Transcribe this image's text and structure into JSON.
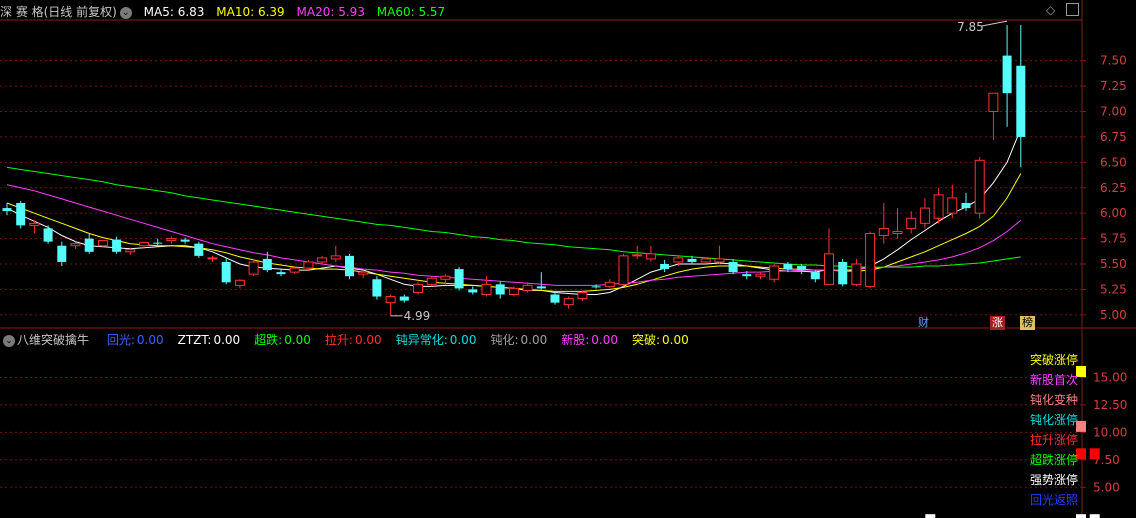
{
  "main_header": {
    "title": "深 赛 格(日线 前复权)",
    "ma5": "MA5: 6.83",
    "ma10": "MA10: 6.39",
    "ma20": "MA20: 5.93",
    "ma60": "MA60: 5.57",
    "colors": {
      "ma5": "#ffffff",
      "ma10": "#ffff00",
      "ma20": "#ff40ff",
      "ma60": "#00ff00"
    }
  },
  "sub_header": {
    "title": "八维突破擒牛",
    "items": [
      {
        "label": "回光:",
        "value": "0.00",
        "color": "#3c64ff"
      },
      {
        "label": "ZTZT:",
        "value": "0.00",
        "color": "#ffffff"
      },
      {
        "label": "超跌:",
        "value": "0.00",
        "color": "#00ff00"
      },
      {
        "label": "拉升:",
        "value": "0.00",
        "color": "#ff3030"
      },
      {
        "label": "钝异常化:",
        "value": "0.00",
        "color": "#00e0e0"
      },
      {
        "label": "钝化:",
        "value": "0.00",
        "color": "#a0a0a0"
      },
      {
        "label": "新股:",
        "value": "0.00",
        "color": "#ff40ff"
      },
      {
        "label": "突破:",
        "value": "0.00",
        "color": "#ffff00"
      }
    ]
  },
  "price_annotations": {
    "high": "7.85",
    "low": "4.99"
  },
  "badges": {
    "cai": "财",
    "zhang": "涨",
    "bang": "榜"
  },
  "corner_icons": [
    "diamond-icon",
    "window-icon"
  ],
  "signal_labels": [
    {
      "text": "突破涨停",
      "color": "#ffff00"
    },
    {
      "text": "新股首次",
      "color": "#ff40ff"
    },
    {
      "text": "钝化变种",
      "color": "#ff8080"
    },
    {
      "text": "钝化涨停",
      "color": "#00e0e0"
    },
    {
      "text": "拉升涨停",
      "color": "#ff3030"
    },
    {
      "text": "超跌涨停",
      "color": "#00ff00"
    },
    {
      "text": "强势涨停",
      "color": "#ffffff"
    },
    {
      "text": "回光返照",
      "color": "#2040ff"
    }
  ],
  "chart_data": [
    {
      "type": "candlestick",
      "yticks": [
        "7.50",
        "7.25",
        "7.00",
        "6.75",
        "6.50",
        "6.25",
        "6.00",
        "5.75",
        "5.50",
        "5.25",
        "5.00"
      ],
      "ylim": [
        4.9,
        7.9
      ],
      "candles": [
        [
          6.05,
          6.1,
          5.98,
          6.02
        ],
        [
          6.1,
          6.12,
          5.85,
          5.88
        ],
        [
          5.88,
          5.93,
          5.8,
          5.9
        ],
        [
          5.85,
          5.88,
          5.7,
          5.72
        ],
        [
          5.68,
          5.72,
          5.48,
          5.52
        ],
        [
          5.68,
          5.72,
          5.65,
          5.7
        ],
        [
          5.75,
          5.8,
          5.6,
          5.62
        ],
        [
          5.68,
          5.74,
          5.66,
          5.73
        ],
        [
          5.74,
          5.77,
          5.6,
          5.62
        ],
        [
          5.62,
          5.66,
          5.59,
          5.64
        ],
        [
          5.68,
          5.72,
          5.65,
          5.71
        ],
        [
          5.71,
          5.75,
          5.68,
          5.7
        ],
        [
          5.73,
          5.77,
          5.7,
          5.75
        ],
        [
          5.74,
          5.76,
          5.7,
          5.72
        ],
        [
          5.7,
          5.72,
          5.56,
          5.58
        ],
        [
          5.55,
          5.58,
          5.52,
          5.56
        ],
        [
          5.52,
          5.56,
          5.3,
          5.32
        ],
        [
          5.29,
          5.35,
          5.26,
          5.34
        ],
        [
          5.4,
          5.55,
          5.38,
          5.52
        ],
        [
          5.55,
          5.62,
          5.42,
          5.44
        ],
        [
          5.42,
          5.45,
          5.38,
          5.4
        ],
        [
          5.42,
          5.48,
          5.4,
          5.46
        ],
        [
          5.46,
          5.54,
          5.44,
          5.52
        ],
        [
          5.52,
          5.58,
          5.5,
          5.56
        ],
        [
          5.55,
          5.68,
          5.52,
          5.58
        ],
        [
          5.58,
          5.6,
          5.35,
          5.38
        ],
        [
          5.4,
          5.44,
          5.36,
          5.42
        ],
        [
          5.35,
          5.38,
          5.15,
          5.18
        ],
        [
          5.12,
          5.2,
          4.99,
          5.18
        ],
        [
          5.18,
          5.2,
          5.12,
          5.14
        ],
        [
          5.22,
          5.32,
          5.2,
          5.3
        ],
        [
          5.3,
          5.38,
          5.28,
          5.36
        ],
        [
          5.35,
          5.4,
          5.3,
          5.38
        ],
        [
          5.45,
          5.47,
          5.24,
          5.26
        ],
        [
          5.25,
          5.28,
          5.2,
          5.22
        ],
        [
          5.2,
          5.38,
          5.18,
          5.3
        ],
        [
          5.3,
          5.33,
          5.16,
          5.2
        ],
        [
          5.2,
          5.28,
          5.18,
          5.26
        ],
        [
          5.24,
          5.32,
          5.22,
          5.29
        ],
        [
          5.28,
          5.42,
          5.25,
          5.26
        ],
        [
          5.2,
          5.23,
          5.1,
          5.12
        ],
        [
          5.1,
          5.18,
          5.06,
          5.16
        ],
        [
          5.16,
          5.24,
          5.14,
          5.22
        ],
        [
          5.28,
          5.3,
          5.26,
          5.27
        ],
        [
          5.28,
          5.35,
          5.26,
          5.32
        ],
        [
          5.3,
          5.6,
          5.28,
          5.58
        ],
        [
          5.58,
          5.68,
          5.55,
          5.59
        ],
        [
          5.55,
          5.68,
          5.52,
          5.6
        ],
        [
          5.5,
          5.54,
          5.42,
          5.45
        ],
        [
          5.52,
          5.58,
          5.48,
          5.56
        ],
        [
          5.55,
          5.58,
          5.5,
          5.52
        ],
        [
          5.52,
          5.56,
          5.5,
          5.55
        ],
        [
          5.52,
          5.68,
          5.5,
          5.55
        ],
        [
          5.52,
          5.55,
          5.4,
          5.42
        ],
        [
          5.4,
          5.43,
          5.35,
          5.38
        ],
        [
          5.38,
          5.42,
          5.35,
          5.4
        ],
        [
          5.35,
          5.5,
          5.32,
          5.48
        ],
        [
          5.5,
          5.52,
          5.42,
          5.45
        ],
        [
          5.48,
          5.5,
          5.4,
          5.44
        ],
        [
          5.42,
          5.44,
          5.32,
          5.35
        ],
        [
          5.3,
          5.85,
          5.3,
          5.6
        ],
        [
          5.52,
          5.55,
          5.28,
          5.3
        ],
        [
          5.3,
          5.55,
          5.28,
          5.5
        ],
        [
          5.28,
          5.82,
          5.26,
          5.8
        ],
        [
          5.78,
          6.1,
          5.7,
          5.85
        ],
        [
          5.8,
          6.05,
          5.75,
          5.82
        ],
        [
          5.85,
          6.02,
          5.8,
          5.95
        ],
        [
          5.9,
          6.15,
          5.85,
          6.05
        ],
        [
          5.95,
          6.25,
          5.9,
          6.18
        ],
        [
          6.0,
          6.28,
          5.95,
          6.15
        ],
        [
          6.1,
          6.2,
          6.02,
          6.05
        ],
        [
          6.0,
          6.55,
          5.95,
          6.52
        ],
        [
          7.0,
          7.18,
          6.72,
          7.18
        ],
        [
          7.55,
          7.85,
          6.85,
          7.18
        ],
        [
          7.45,
          7.85,
          6.45,
          6.75
        ]
      ],
      "ma_series": [
        {
          "name": "MA5",
          "color": "#ffffff",
          "values": [
            6.05,
            5.98,
            5.92,
            5.86,
            5.78,
            5.72,
            5.68,
            5.67,
            5.66,
            5.65,
            5.66,
            5.67,
            5.68,
            5.68,
            5.66,
            5.62,
            5.56,
            5.5,
            5.47,
            5.46,
            5.45,
            5.44,
            5.44,
            5.46,
            5.48,
            5.46,
            5.44,
            5.4,
            5.35,
            5.3,
            5.28,
            5.28,
            5.29,
            5.29,
            5.29,
            5.28,
            5.27,
            5.26,
            5.24,
            5.24,
            5.22,
            5.21,
            5.2,
            5.2,
            5.22,
            5.28,
            5.35,
            5.42,
            5.46,
            5.5,
            5.5,
            5.5,
            5.51,
            5.5,
            5.48,
            5.46,
            5.44,
            5.43,
            5.43,
            5.42,
            5.45,
            5.43,
            5.44,
            5.48,
            5.55,
            5.64,
            5.74,
            5.83,
            5.92,
            6.0,
            6.06,
            6.14,
            6.3,
            6.5,
            6.83
          ]
        },
        {
          "name": "MA10",
          "color": "#ffff00",
          "values": [
            6.1,
            6.05,
            6.0,
            5.95,
            5.9,
            5.85,
            5.8,
            5.76,
            5.73,
            5.7,
            5.69,
            5.68,
            5.68,
            5.67,
            5.66,
            5.64,
            5.61,
            5.57,
            5.54,
            5.51,
            5.49,
            5.47,
            5.46,
            5.45,
            5.45,
            5.44,
            5.42,
            5.4,
            5.38,
            5.36,
            5.34,
            5.32,
            5.31,
            5.3,
            5.29,
            5.28,
            5.27,
            5.26,
            5.25,
            5.24,
            5.23,
            5.23,
            5.23,
            5.24,
            5.25,
            5.27,
            5.3,
            5.34,
            5.38,
            5.42,
            5.45,
            5.47,
            5.48,
            5.48,
            5.48,
            5.47,
            5.46,
            5.45,
            5.45,
            5.44,
            5.44,
            5.43,
            5.43,
            5.44,
            5.47,
            5.52,
            5.57,
            5.62,
            5.68,
            5.74,
            5.8,
            5.87,
            5.97,
            6.15,
            6.39
          ]
        },
        {
          "name": "MA20",
          "color": "#ff40ff",
          "values": [
            6.28,
            6.25,
            6.22,
            6.18,
            6.14,
            6.1,
            6.06,
            6.02,
            5.98,
            5.94,
            5.9,
            5.86,
            5.82,
            5.78,
            5.74,
            5.7,
            5.67,
            5.64,
            5.61,
            5.59,
            5.56,
            5.54,
            5.52,
            5.5,
            5.48,
            5.47,
            5.45,
            5.44,
            5.42,
            5.41,
            5.39,
            5.38,
            5.37,
            5.36,
            5.35,
            5.34,
            5.33,
            5.32,
            5.31,
            5.3,
            5.29,
            5.29,
            5.29,
            5.29,
            5.3,
            5.31,
            5.32,
            5.34,
            5.35,
            5.37,
            5.38,
            5.39,
            5.4,
            5.41,
            5.42,
            5.42,
            5.43,
            5.43,
            5.44,
            5.44,
            5.44,
            5.44,
            5.45,
            5.46,
            5.47,
            5.48,
            5.5,
            5.52,
            5.54,
            5.57,
            5.61,
            5.66,
            5.73,
            5.82,
            5.93
          ]
        },
        {
          "name": "MA60",
          "color": "#00ff00",
          "values": [
            6.45,
            6.43,
            6.41,
            6.39,
            6.37,
            6.35,
            6.33,
            6.31,
            6.28,
            6.26,
            6.24,
            6.22,
            6.2,
            6.17,
            6.15,
            6.13,
            6.11,
            6.09,
            6.07,
            6.05,
            6.03,
            6.01,
            5.99,
            5.97,
            5.95,
            5.93,
            5.91,
            5.89,
            5.88,
            5.86,
            5.84,
            5.82,
            5.81,
            5.79,
            5.77,
            5.76,
            5.74,
            5.73,
            5.71,
            5.7,
            5.69,
            5.67,
            5.66,
            5.65,
            5.64,
            5.62,
            5.61,
            5.6,
            5.59,
            5.58,
            5.57,
            5.56,
            5.55,
            5.54,
            5.53,
            5.52,
            5.51,
            5.5,
            5.49,
            5.49,
            5.48,
            5.48,
            5.47,
            5.47,
            5.47,
            5.47,
            5.47,
            5.48,
            5.48,
            5.49,
            5.5,
            5.51,
            5.53,
            5.55,
            5.57
          ]
        }
      ]
    },
    {
      "type": "signal-markers",
      "yticks": [
        "15.00",
        "12.50",
        "10.00",
        "7.50",
        "5.00"
      ],
      "ylim": [
        2.2,
        17.5
      ],
      "markers": [
        {
          "candle": 70,
          "level": 15.5,
          "color": "#ffff00"
        },
        {
          "candle": 70,
          "level": 10.5,
          "color": "#ff8080"
        },
        {
          "candle": 70,
          "level": 8.0,
          "color": "#ff0000"
        },
        {
          "candle": 71,
          "level": 8.0,
          "color": "#ff0000"
        },
        {
          "candle": 70,
          "level": 2.0,
          "color": "#ffffff"
        },
        {
          "candle": 71,
          "level": 2.0,
          "color": "#ffffff"
        },
        {
          "candle": 59,
          "level": 2.0,
          "color": "#ffffff"
        }
      ]
    }
  ]
}
